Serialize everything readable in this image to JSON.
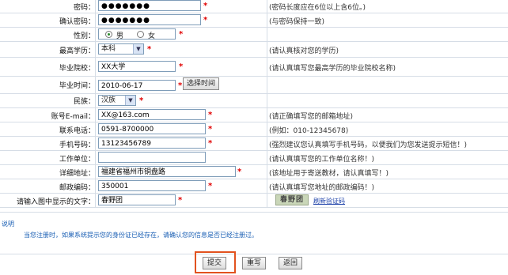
{
  "fields": {
    "password": {
      "label": "密码：",
      "value": "●●●●●●●",
      "note": "(密码长度应在6位以上含6位。)"
    },
    "confirm": {
      "label": "确认密码：",
      "value": "●●●●●●●",
      "note": "(与密码保持一致)"
    },
    "gender": {
      "label": "性别：",
      "male": "男",
      "female": "女"
    },
    "education": {
      "label": "最高学历：",
      "value": "本科",
      "note": "(请认真核对您的学历)"
    },
    "school": {
      "label": "毕业院校：",
      "value": "XX大学",
      "note": "(请认真填写您最高学历的毕业院校名称)"
    },
    "grad_time": {
      "label": "毕业时间：",
      "value": "2010-06-17",
      "button": "选择时间"
    },
    "ethnicity": {
      "label": "民族：",
      "value": "汉族"
    },
    "email": {
      "label": "账号E-mail：",
      "value": "XX@163.com",
      "note": "(请正确填写您的邮箱地址)"
    },
    "phone": {
      "label": "联系电话：",
      "value": "0591-8700000",
      "note": "(例如：010-12345678)"
    },
    "mobile": {
      "label": "手机号码：",
      "value": "13123456789",
      "note": "(强烈建议您认真填写手机号码，以便我们为您发送提示短信！)"
    },
    "employer": {
      "label": "工作单位：",
      "value": "",
      "note": "(请认真填写您的工作单位名称！)"
    },
    "address": {
      "label": "详细地址：",
      "value": "福建省福州市铜盘路",
      "note": "(该地址用于寄送教材，请认真填写！)"
    },
    "postcode": {
      "label": "邮政编码：",
      "value": "350001",
      "note": "(请认真填写您地址的邮政编码！)"
    },
    "captcha": {
      "label": "请输入图中显示的文字：",
      "value": "春野团",
      "image_text": "春野团",
      "refresh": "刷新验证码"
    }
  },
  "required_mark": "*",
  "notice": {
    "title": "说明",
    "text": "当您注册时，如果系统提示您的身份证已经存在，请确认您的信息是否已经注册过。"
  },
  "buttons": {
    "submit": "提交",
    "reset": "重写",
    "back": "返回"
  },
  "colors": {
    "required": "#e00000",
    "highlight": "#e2521f",
    "link": "#1a5fb4"
  }
}
